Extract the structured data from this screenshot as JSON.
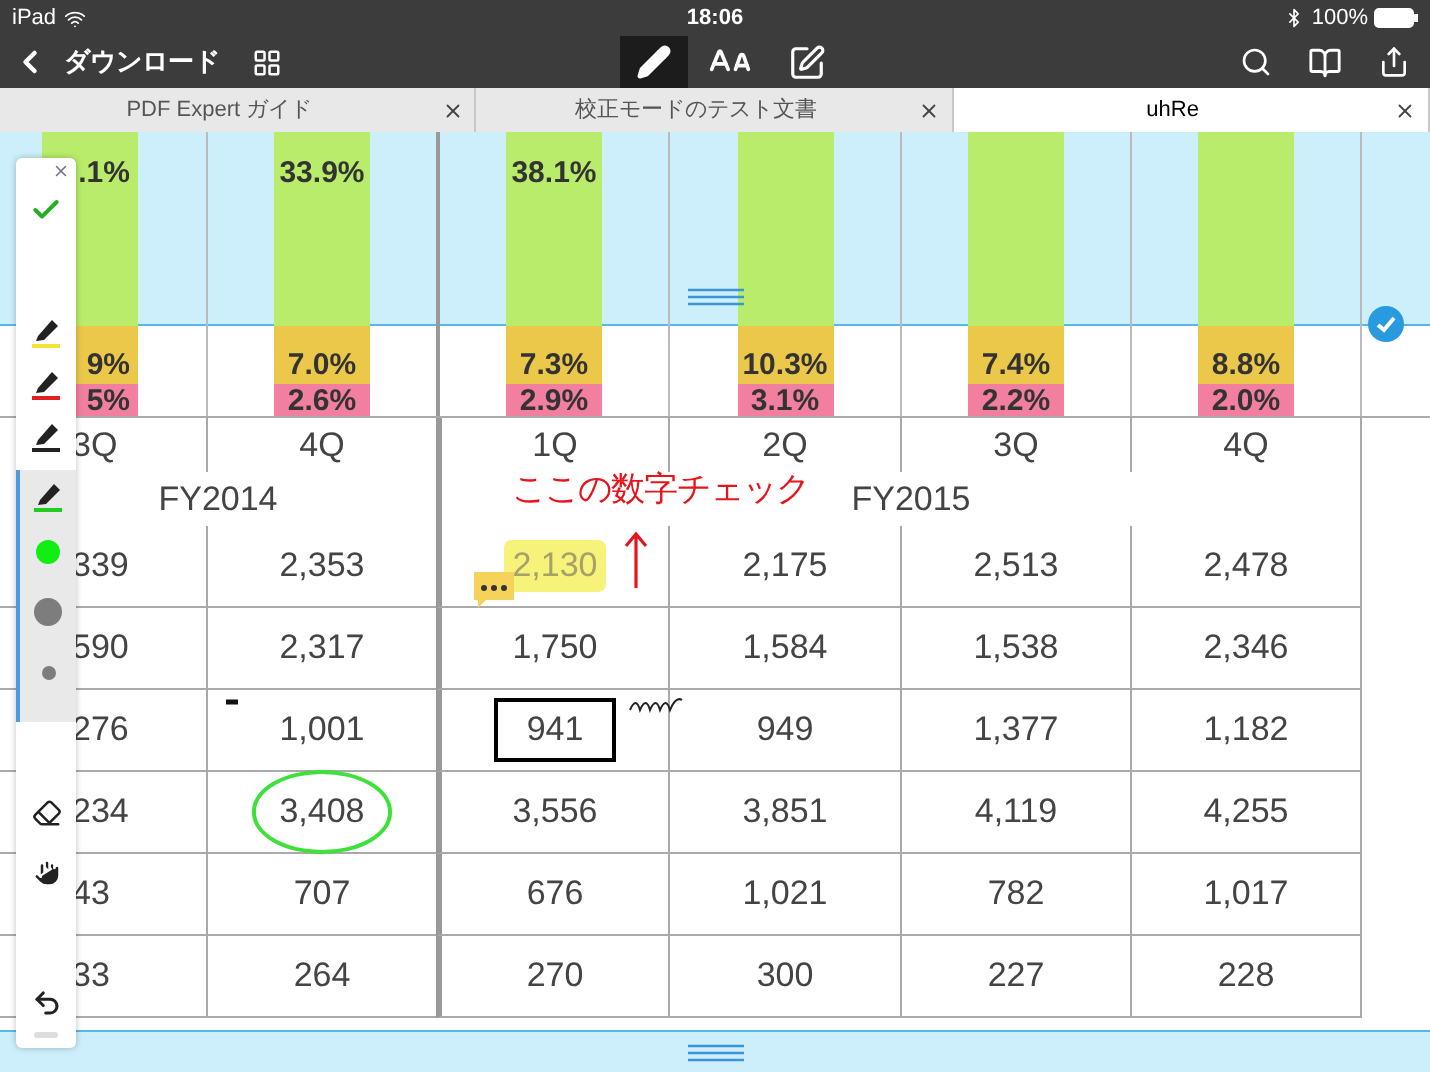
{
  "status_bar": {
    "device": "iPad",
    "time": "18:06",
    "battery": "100%"
  },
  "toolbar": {
    "back_label": "ダウンロード",
    "tools": [
      {
        "kind": "pen",
        "selected": true
      },
      {
        "kind": "text",
        "selected": false
      },
      {
        "kind": "edit",
        "selected": false
      }
    ]
  },
  "tabs": [
    {
      "label": "PDF Expert ガイド",
      "selected": false
    },
    {
      "label": "校正モードのテスト文書",
      "selected": false
    },
    {
      "label": "uhRe",
      "selected": true
    }
  ],
  "palette": [
    {
      "kind": "close"
    },
    {
      "kind": "check"
    },
    {
      "kind": "pen",
      "color": "#f2e430",
      "selected": false
    },
    {
      "kind": "pen",
      "color": "#e02020",
      "selected": false
    },
    {
      "kind": "pen",
      "color": "#222222",
      "selected": false
    },
    {
      "kind": "pen",
      "color": "#22cc22",
      "selected": true,
      "options": [
        {
          "kind": "color",
          "color": "#11ee11"
        },
        {
          "kind": "opacity"
        },
        {
          "kind": "thickness"
        }
      ]
    },
    {
      "kind": "eraser"
    },
    {
      "kind": "hand"
    },
    {
      "kind": "undo"
    }
  ],
  "chart_columns": [
    {
      "top_label": ".1%",
      "middle_label": "9%",
      "bottom_label": "5%"
    },
    {
      "top_label": "33.9%",
      "middle_label": "7.0%",
      "bottom_label": "2.6%"
    },
    {
      "top_label": "38.1%",
      "middle_label": "7.3%",
      "bottom_label": "2.9%"
    },
    {
      "middle_label": "10.3%",
      "bottom_label": "3.1%"
    },
    {
      "middle_label": "7.4%",
      "bottom_label": "2.2%"
    },
    {
      "middle_label": "8.8%",
      "bottom_label": "2.0%"
    }
  ],
  "table": {
    "quarters": [
      "3Q",
      "4Q",
      "1Q",
      "2Q",
      "3Q",
      "4Q"
    ],
    "years": [
      "FY2014",
      "FY2015"
    ],
    "rows": [
      [
        {
          "text": "339",
          "highlighted": false,
          "boxed": false,
          "circled": false
        },
        {
          "text": "2,353",
          "highlighted": false,
          "boxed": false,
          "circled": false
        },
        {
          "text": "2,130",
          "highlighted": true,
          "boxed": false,
          "circled": false
        },
        {
          "text": "2,175",
          "highlighted": false,
          "boxed": false,
          "circled": false
        },
        {
          "text": "2,513",
          "highlighted": false,
          "boxed": false,
          "circled": false
        },
        {
          "text": "2,478",
          "highlighted": false,
          "boxed": false,
          "circled": false
        }
      ],
      [
        {
          "text": "590",
          "highlighted": false,
          "boxed": false,
          "circled": false
        },
        {
          "text": "2,317",
          "highlighted": false,
          "boxed": false,
          "circled": false
        },
        {
          "text": "1,750",
          "highlighted": false,
          "boxed": false,
          "circled": false
        },
        {
          "text": "1,584",
          "highlighted": false,
          "boxed": false,
          "circled": false
        },
        {
          "text": "1,538",
          "highlighted": false,
          "boxed": false,
          "circled": false
        },
        {
          "text": "2,346",
          "highlighted": false,
          "boxed": false,
          "circled": false
        }
      ],
      [
        {
          "text": "276",
          "highlighted": false,
          "boxed": false,
          "circled": false
        },
        {
          "text": "1,001",
          "highlighted": false,
          "boxed": false,
          "circled": false
        },
        {
          "text": "941",
          "highlighted": false,
          "boxed": true,
          "circled": false
        },
        {
          "text": "949",
          "highlighted": false,
          "boxed": false,
          "circled": false
        },
        {
          "text": "1,377",
          "highlighted": false,
          "boxed": false,
          "circled": false
        },
        {
          "text": "1,182",
          "highlighted": false,
          "boxed": false,
          "circled": false
        }
      ],
      [
        {
          "text": "234",
          "highlighted": false,
          "boxed": false,
          "circled": false
        },
        {
          "text": "3,408",
          "highlighted": false,
          "boxed": false,
          "circled": true
        },
        {
          "text": "3,556",
          "highlighted": false,
          "boxed": false,
          "circled": false
        },
        {
          "text": "3,851",
          "highlighted": false,
          "boxed": false,
          "circled": false
        },
        {
          "text": "4,119",
          "highlighted": false,
          "boxed": false,
          "circled": false
        },
        {
          "text": "4,255",
          "highlighted": false,
          "boxed": false,
          "circled": false
        }
      ],
      [
        {
          "text": "43",
          "highlighted": false,
          "boxed": false,
          "circled": false
        },
        {
          "text": "707",
          "highlighted": false,
          "boxed": false,
          "circled": false
        },
        {
          "text": "676",
          "highlighted": false,
          "boxed": false,
          "circled": false
        },
        {
          "text": "1,021",
          "highlighted": false,
          "boxed": false,
          "circled": false
        },
        {
          "text": "782",
          "highlighted": false,
          "boxed": false,
          "circled": false
        },
        {
          "text": "1,017",
          "highlighted": false,
          "boxed": false,
          "circled": false
        }
      ],
      [
        {
          "text": "33",
          "highlighted": false,
          "boxed": false,
          "circled": false
        },
        {
          "text": "264",
          "highlighted": false,
          "boxed": false,
          "circled": false
        },
        {
          "text": "270",
          "highlighted": false,
          "boxed": false,
          "circled": false
        },
        {
          "text": "300",
          "highlighted": false,
          "boxed": false,
          "circled": false
        },
        {
          "text": "227",
          "highlighted": false,
          "boxed": false,
          "circled": false
        },
        {
          "text": "228",
          "highlighted": false,
          "boxed": false,
          "circled": false
        }
      ]
    ]
  },
  "ink_note": {
    "text": "ここの数字チェック",
    "color": "#e8141c"
  }
}
